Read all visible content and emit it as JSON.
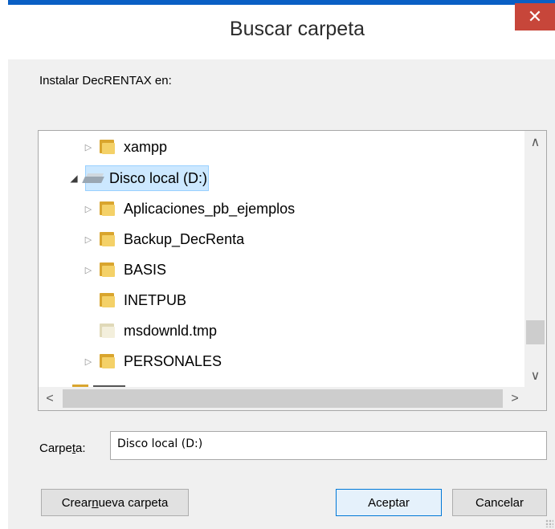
{
  "window": {
    "title": "Buscar carpeta",
    "close_glyph": "✕"
  },
  "instruction": "Instalar DecRENTAX en:",
  "tree": {
    "items": [
      {
        "label": "xampp",
        "icon": "folder-icon",
        "arrow": "▷"
      },
      {
        "label": "Disco local (D:)",
        "icon": "drive-icon",
        "arrow": "◢",
        "selected": true
      },
      {
        "label": "Aplicaciones_pb_ejemplos",
        "icon": "folder-icon",
        "arrow": "▷"
      },
      {
        "label": "Backup_DecRenta",
        "icon": "folder-icon",
        "arrow": "▷"
      },
      {
        "label": "BASIS",
        "icon": "folder-icon",
        "arrow": "▷"
      },
      {
        "label": "INETPUB",
        "icon": "folder-icon",
        "arrow": ""
      },
      {
        "label": "msdownld.tmp",
        "icon": "file-folder-icon",
        "arrow": ""
      },
      {
        "label": "PERSONALES",
        "icon": "folder-icon",
        "arrow": "▷"
      }
    ],
    "scroll": {
      "up": "∧",
      "down": "∨",
      "left": "<",
      "right": ">"
    }
  },
  "folder_field": {
    "label_before": "Carpe",
    "label_access": "t",
    "label_after": "a:",
    "value": "Disco local (D:)"
  },
  "buttons": {
    "new_folder_before": "Crear ",
    "new_folder_access": "n",
    "new_folder_after": "ueva carpeta",
    "accept": "Aceptar",
    "cancel": "Cancelar"
  },
  "colors": {
    "accent": "#0a5fc4",
    "close": "#c7463a",
    "selection": "#cce8ff"
  }
}
